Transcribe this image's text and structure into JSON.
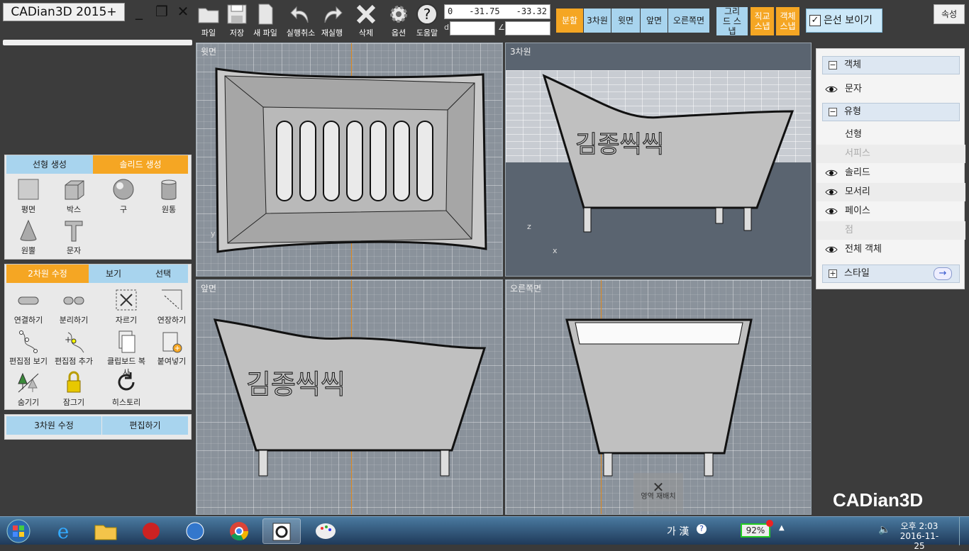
{
  "app": {
    "title": "CADian3D 2015+",
    "logo": "CADian3D"
  },
  "window_controls": [
    {
      "icon": "minimize-icon",
      "glyph": "_"
    },
    {
      "icon": "restore-icon",
      "glyph": "❐"
    },
    {
      "icon": "close-icon",
      "glyph": "✕"
    }
  ],
  "toolbar": {
    "file": "파일",
    "save": "저장",
    "new_file": "새 파일",
    "undo": "실행취소",
    "redo": "재실행",
    "delete": "삭제",
    "options": "옵션",
    "help": "도움말"
  },
  "coords": {
    "a": "0",
    "b": "-31.75",
    "c": "-33.32",
    "d_label": "d",
    "angle_label": "∠"
  },
  "view_buttons": {
    "split": "분할",
    "three_d": "3차원",
    "top": "윗면",
    "front": "앞면",
    "right": "오른쪽면"
  },
  "snap": {
    "grid": "그리드 스냅",
    "ortho": "직교 스냅",
    "object": "객체 스냅"
  },
  "hidden_lines": {
    "label": "은선 보이기",
    "checked": true
  },
  "properties_button": "속성",
  "left_panel": {
    "tabs1": [
      "선형 생성",
      "솔리드 생성"
    ],
    "solid_tools": [
      "평면",
      "박스",
      "구",
      "원통",
      "원뿔",
      "문자"
    ],
    "tabs2": [
      "2차원 수정",
      "보기",
      "선택"
    ],
    "edit_tools": [
      "연결하기",
      "분리하기",
      "자르기",
      "연장하기",
      "편집점 보기",
      "편집점 추가",
      "클립보드 복사",
      "붙여넣기",
      "숨기기",
      "잠그기",
      "히스토리"
    ],
    "tabs3": [
      "3차원 수정",
      "편집하기"
    ]
  },
  "viewports": {
    "top": "윗면",
    "three_d": "3차원",
    "front": "앞면",
    "right": "오른쪽면",
    "rearrange": "영역 재배치"
  },
  "model_text": "김종씩씩",
  "axes": {
    "x": "x",
    "y": "y",
    "z": "z"
  },
  "right_panel": {
    "objects_header": "객체",
    "text_item": "문자",
    "types_header": "유형",
    "types": [
      {
        "label": "선형",
        "eye": false,
        "dim": false
      },
      {
        "label": "서피스",
        "eye": false,
        "dim": true
      },
      {
        "label": "솔리드",
        "eye": true,
        "dim": false
      },
      {
        "label": "모서리",
        "eye": true,
        "dim": false
      },
      {
        "label": "페이스",
        "eye": true,
        "dim": false
      },
      {
        "label": "점",
        "eye": false,
        "dim": true
      },
      {
        "label": "전체 객체",
        "eye": true,
        "dim": false
      }
    ],
    "style_header": "스타일"
  },
  "taskbar": {
    "ime": "가 漢",
    "battery": "92%",
    "time": "오후 2:03",
    "date": "2016-11-25"
  }
}
